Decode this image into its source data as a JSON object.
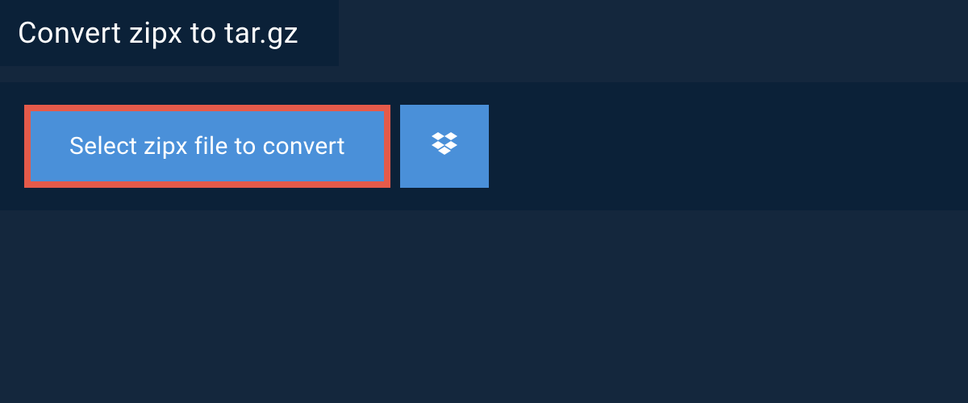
{
  "header": {
    "title": "Convert zipx to tar.gz"
  },
  "actions": {
    "select_file_label": "Select zipx file to convert",
    "dropbox_icon": "dropbox-icon"
  },
  "colors": {
    "background": "#14273d",
    "panel": "#0b2138",
    "button": "#4a90d9",
    "highlight_border": "#e55a4a",
    "text": "#ffffff"
  }
}
